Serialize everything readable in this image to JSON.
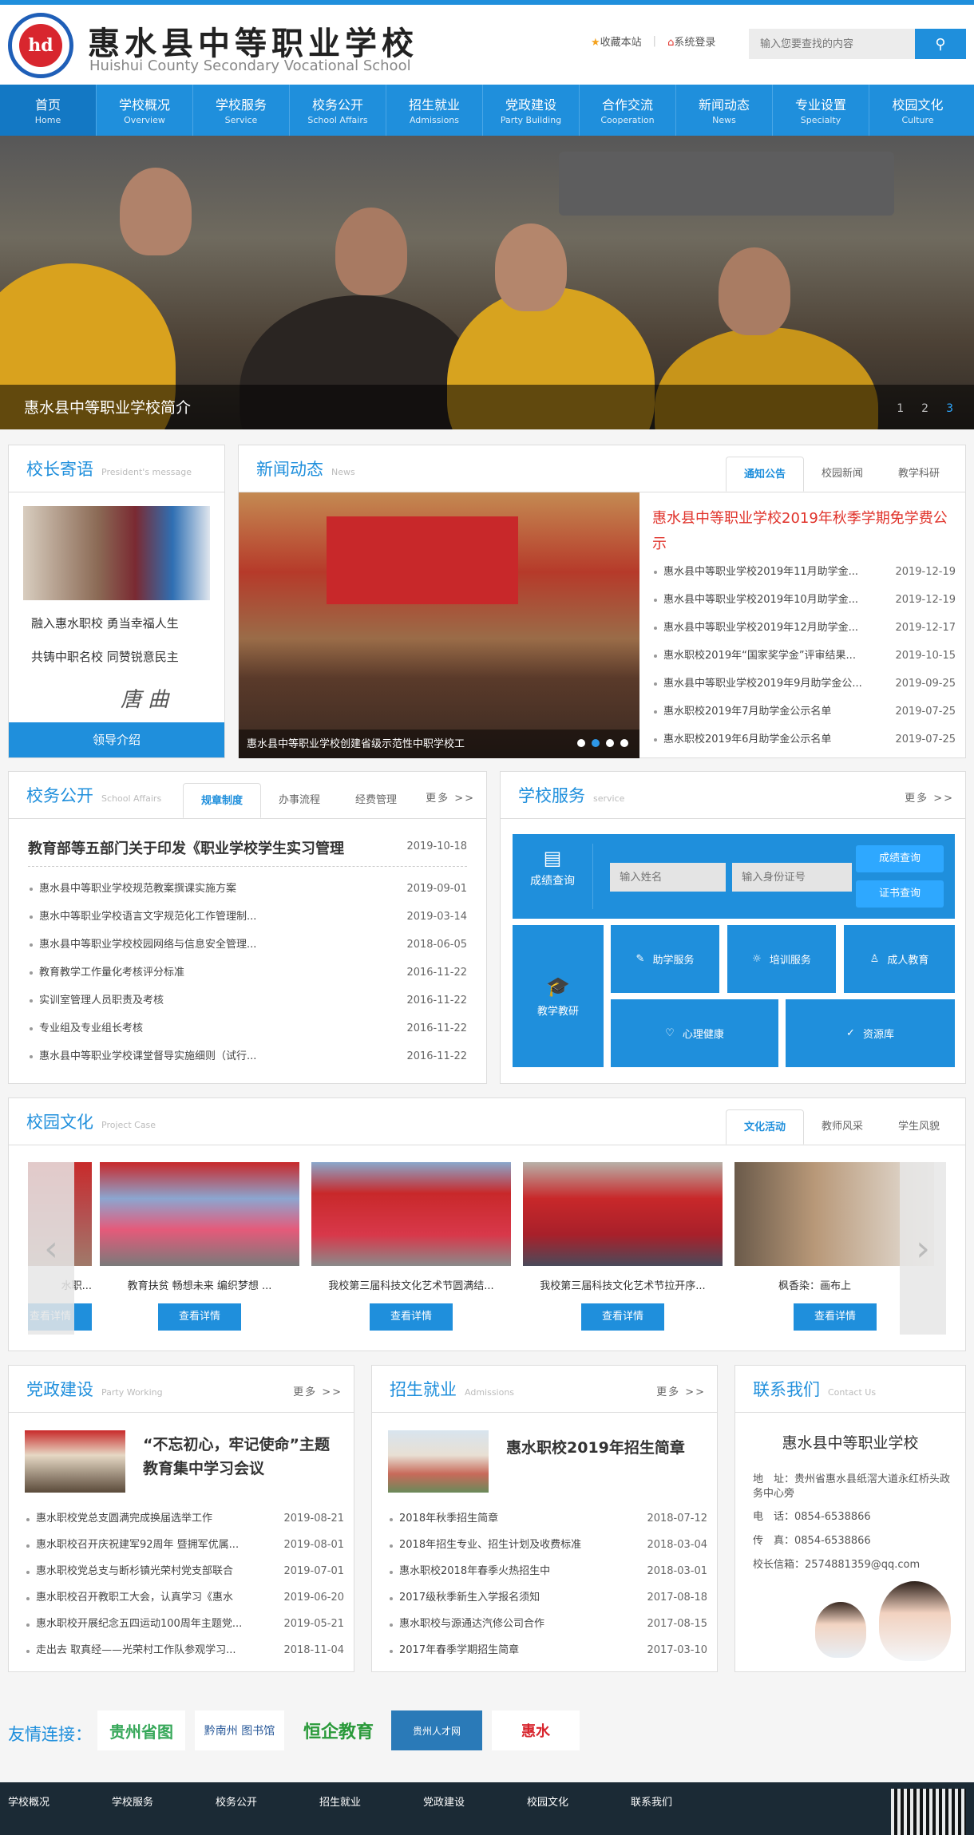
{
  "header": {
    "logo_text": "hd",
    "school_name": "惠水县中等职业学校",
    "school_name_en": "Huishui County Secondary Vocational School",
    "bookmark": "收藏本站",
    "login": "系统登录",
    "search_placeholder": "输入您要查找的内容"
  },
  "nav": [
    {
      "cn": "首页",
      "en": "Home"
    },
    {
      "cn": "学校概况",
      "en": "Overview"
    },
    {
      "cn": "学校服务",
      "en": "Service"
    },
    {
      "cn": "校务公开",
      "en": "School Affairs"
    },
    {
      "cn": "招生就业",
      "en": "Admissions"
    },
    {
      "cn": "党政建设",
      "en": "Party Building"
    },
    {
      "cn": "合作交流",
      "en": "Cooperation"
    },
    {
      "cn": "新闻动态",
      "en": "News"
    },
    {
      "cn": "专业设置",
      "en": "Specialty"
    },
    {
      "cn": "校园文化",
      "en": "Culture"
    }
  ],
  "banner": {
    "caption": "惠水县中等职业学校简介",
    "pages": [
      "1",
      "2",
      "3"
    ]
  },
  "president": {
    "title": "校长寄语",
    "title_en": "President's message",
    "poem1": "融入惠水职校  勇当幸福人生",
    "poem2": "共铸中职名校  同赞锐意民主",
    "signature": "唐 曲",
    "button": "领导介绍"
  },
  "news": {
    "title": "新闻动态",
    "title_en": "News",
    "tabs": [
      "通知公告",
      "校园新闻",
      "教学科研"
    ],
    "photo_caption": "惠水县中等职业学校创建省级示范性中职学校工",
    "headline": "惠水县中等职业学校2019年秋季学期免学费公示",
    "items": [
      {
        "t": "惠水县中等职业学校2019年11月助学金...",
        "d": "2019-12-19"
      },
      {
        "t": "惠水县中等职业学校2019年10月助学金...",
        "d": "2019-12-19"
      },
      {
        "t": "惠水县中等职业学校2019年12月助学金...",
        "d": "2019-12-17"
      },
      {
        "t": "惠水职校2019年“国家奖学金”评审结果...",
        "d": "2019-10-15"
      },
      {
        "t": "惠水县中等职业学校2019年9月助学金公...",
        "d": "2019-09-25"
      },
      {
        "t": "惠水职校2019年7月助学金公示名单",
        "d": "2019-07-25"
      },
      {
        "t": "惠水职校2019年6月助学金公示名单",
        "d": "2019-07-25"
      }
    ]
  },
  "affairs": {
    "title": "校务公开",
    "title_en": "School Affairs",
    "tabs": [
      "规章制度",
      "办事流程",
      "经费管理"
    ],
    "more": "更多 >>",
    "headline": "教育部等五部门关于印发《职业学校学生实习管理",
    "headline_date": "2019-10-18",
    "items": [
      {
        "t": "惠水县中等职业学校规范教案撰课实施方案",
        "d": "2019-09-01"
      },
      {
        "t": "惠水中等职业学校语言文字规范化工作管理制...",
        "d": "2019-03-14"
      },
      {
        "t": "惠水县中等职业学校校园网络与信息安全管理...",
        "d": "2018-06-05"
      },
      {
        "t": "教育教学工作量化考核评分标准",
        "d": "2016-11-22"
      },
      {
        "t": "实训室管理人员职责及考核",
        "d": "2016-11-22"
      },
      {
        "t": "专业组及专业组长考核",
        "d": "2016-11-22"
      },
      {
        "t": "惠水县中等职业学校课堂督导实施细则（试行...",
        "d": "2016-11-22"
      }
    ]
  },
  "service": {
    "title": "学校服务",
    "title_en": "service",
    "more": "更多 >>",
    "grade_query": "成绩查询",
    "name_placeholder": "输入姓名",
    "id_placeholder": "输入身份证号",
    "btn_grade": "成绩查询",
    "btn_cert": "证书查询",
    "teaching": "教学教研",
    "aid": "助学服务",
    "training": "培训服务",
    "adult": "成人教育",
    "mental": "心理健康",
    "resource": "资源库"
  },
  "culture": {
    "title": "校园文化",
    "title_en": "Project Case",
    "tabs": [
      "文化活动",
      "教师风采",
      "学生风貌"
    ],
    "detail": "查看详情",
    "cards": [
      {
        "c": "水职..."
      },
      {
        "c": "教育扶贫 畅想未来 编织梦想 ..."
      },
      {
        "c": "我校第三届科技文化艺术节圆满结..."
      },
      {
        "c": "我校第三届科技文化艺术节拉开序..."
      },
      {
        "c": "枫香染：画布上"
      }
    ]
  },
  "party": {
    "title": "党政建设",
    "title_en": "Party Working",
    "more": "更多 >>",
    "headline": "“不忘初心，牢记使命”主题教育集中学习会议",
    "items": [
      {
        "t": "惠水职校党总支圆满完成换届选举工作",
        "d": "2019-08-21"
      },
      {
        "t": "惠水职校召开庆祝建军92周年 暨拥军优属...",
        "d": "2019-08-01"
      },
      {
        "t": "惠水职校党总支与断杉镇光荣村党支部联合",
        "d": "2019-07-01"
      },
      {
        "t": "惠水职校召开教职工大会，认真学习《惠水",
        "d": "2019-06-20"
      },
      {
        "t": "惠水职校开展纪念五四运动100周年主题党...",
        "d": "2019-05-21"
      },
      {
        "t": "走出去 取真经——光荣村工作队参观学习...",
        "d": "2018-11-04"
      }
    ]
  },
  "admission": {
    "title": "招生就业",
    "title_en": "Admissions",
    "more": "更多 >>",
    "headline": "惠水职校2019年招生简章",
    "items": [
      {
        "t": "2018年秋季招生简章",
        "d": "2018-07-12"
      },
      {
        "t": "2018年招生专业、招生计划及收费标准",
        "d": "2018-03-04"
      },
      {
        "t": "惠水职校2018年春季火热招生中",
        "d": "2018-03-01"
      },
      {
        "t": "2017级秋季新生入学报名须知",
        "d": "2017-08-18"
      },
      {
        "t": "惠水职校与源通达汽修公司合作",
        "d": "2017-08-15"
      },
      {
        "t": "2017年春季学期招生简章",
        "d": "2017-03-10"
      }
    ]
  },
  "contact": {
    "title": "联系我们",
    "title_en": "Contact Us",
    "org": "惠水县中等职业学校",
    "addr_l": "地　址：",
    "addr": "贵州省惠水县纸滘大道永红桥头政务中心旁",
    "tel_l": "电　话：",
    "tel": "0854-6538866",
    "fax_l": "传　真：",
    "fax": "0854-6538866",
    "mail_l": "校长信箱：",
    "mail": "2574881359@qq.com"
  },
  "friend": {
    "label": "友情连接：",
    "links": [
      "贵州省图",
      "黔南州 图书馆",
      "恒企教育",
      "贵州人才网",
      "惠水"
    ]
  },
  "footer": {
    "links": [
      "学校概况",
      "学校服务",
      "校务公开",
      "招生就业",
      "党政建设",
      "校园文化",
      "联系我们"
    ]
  }
}
